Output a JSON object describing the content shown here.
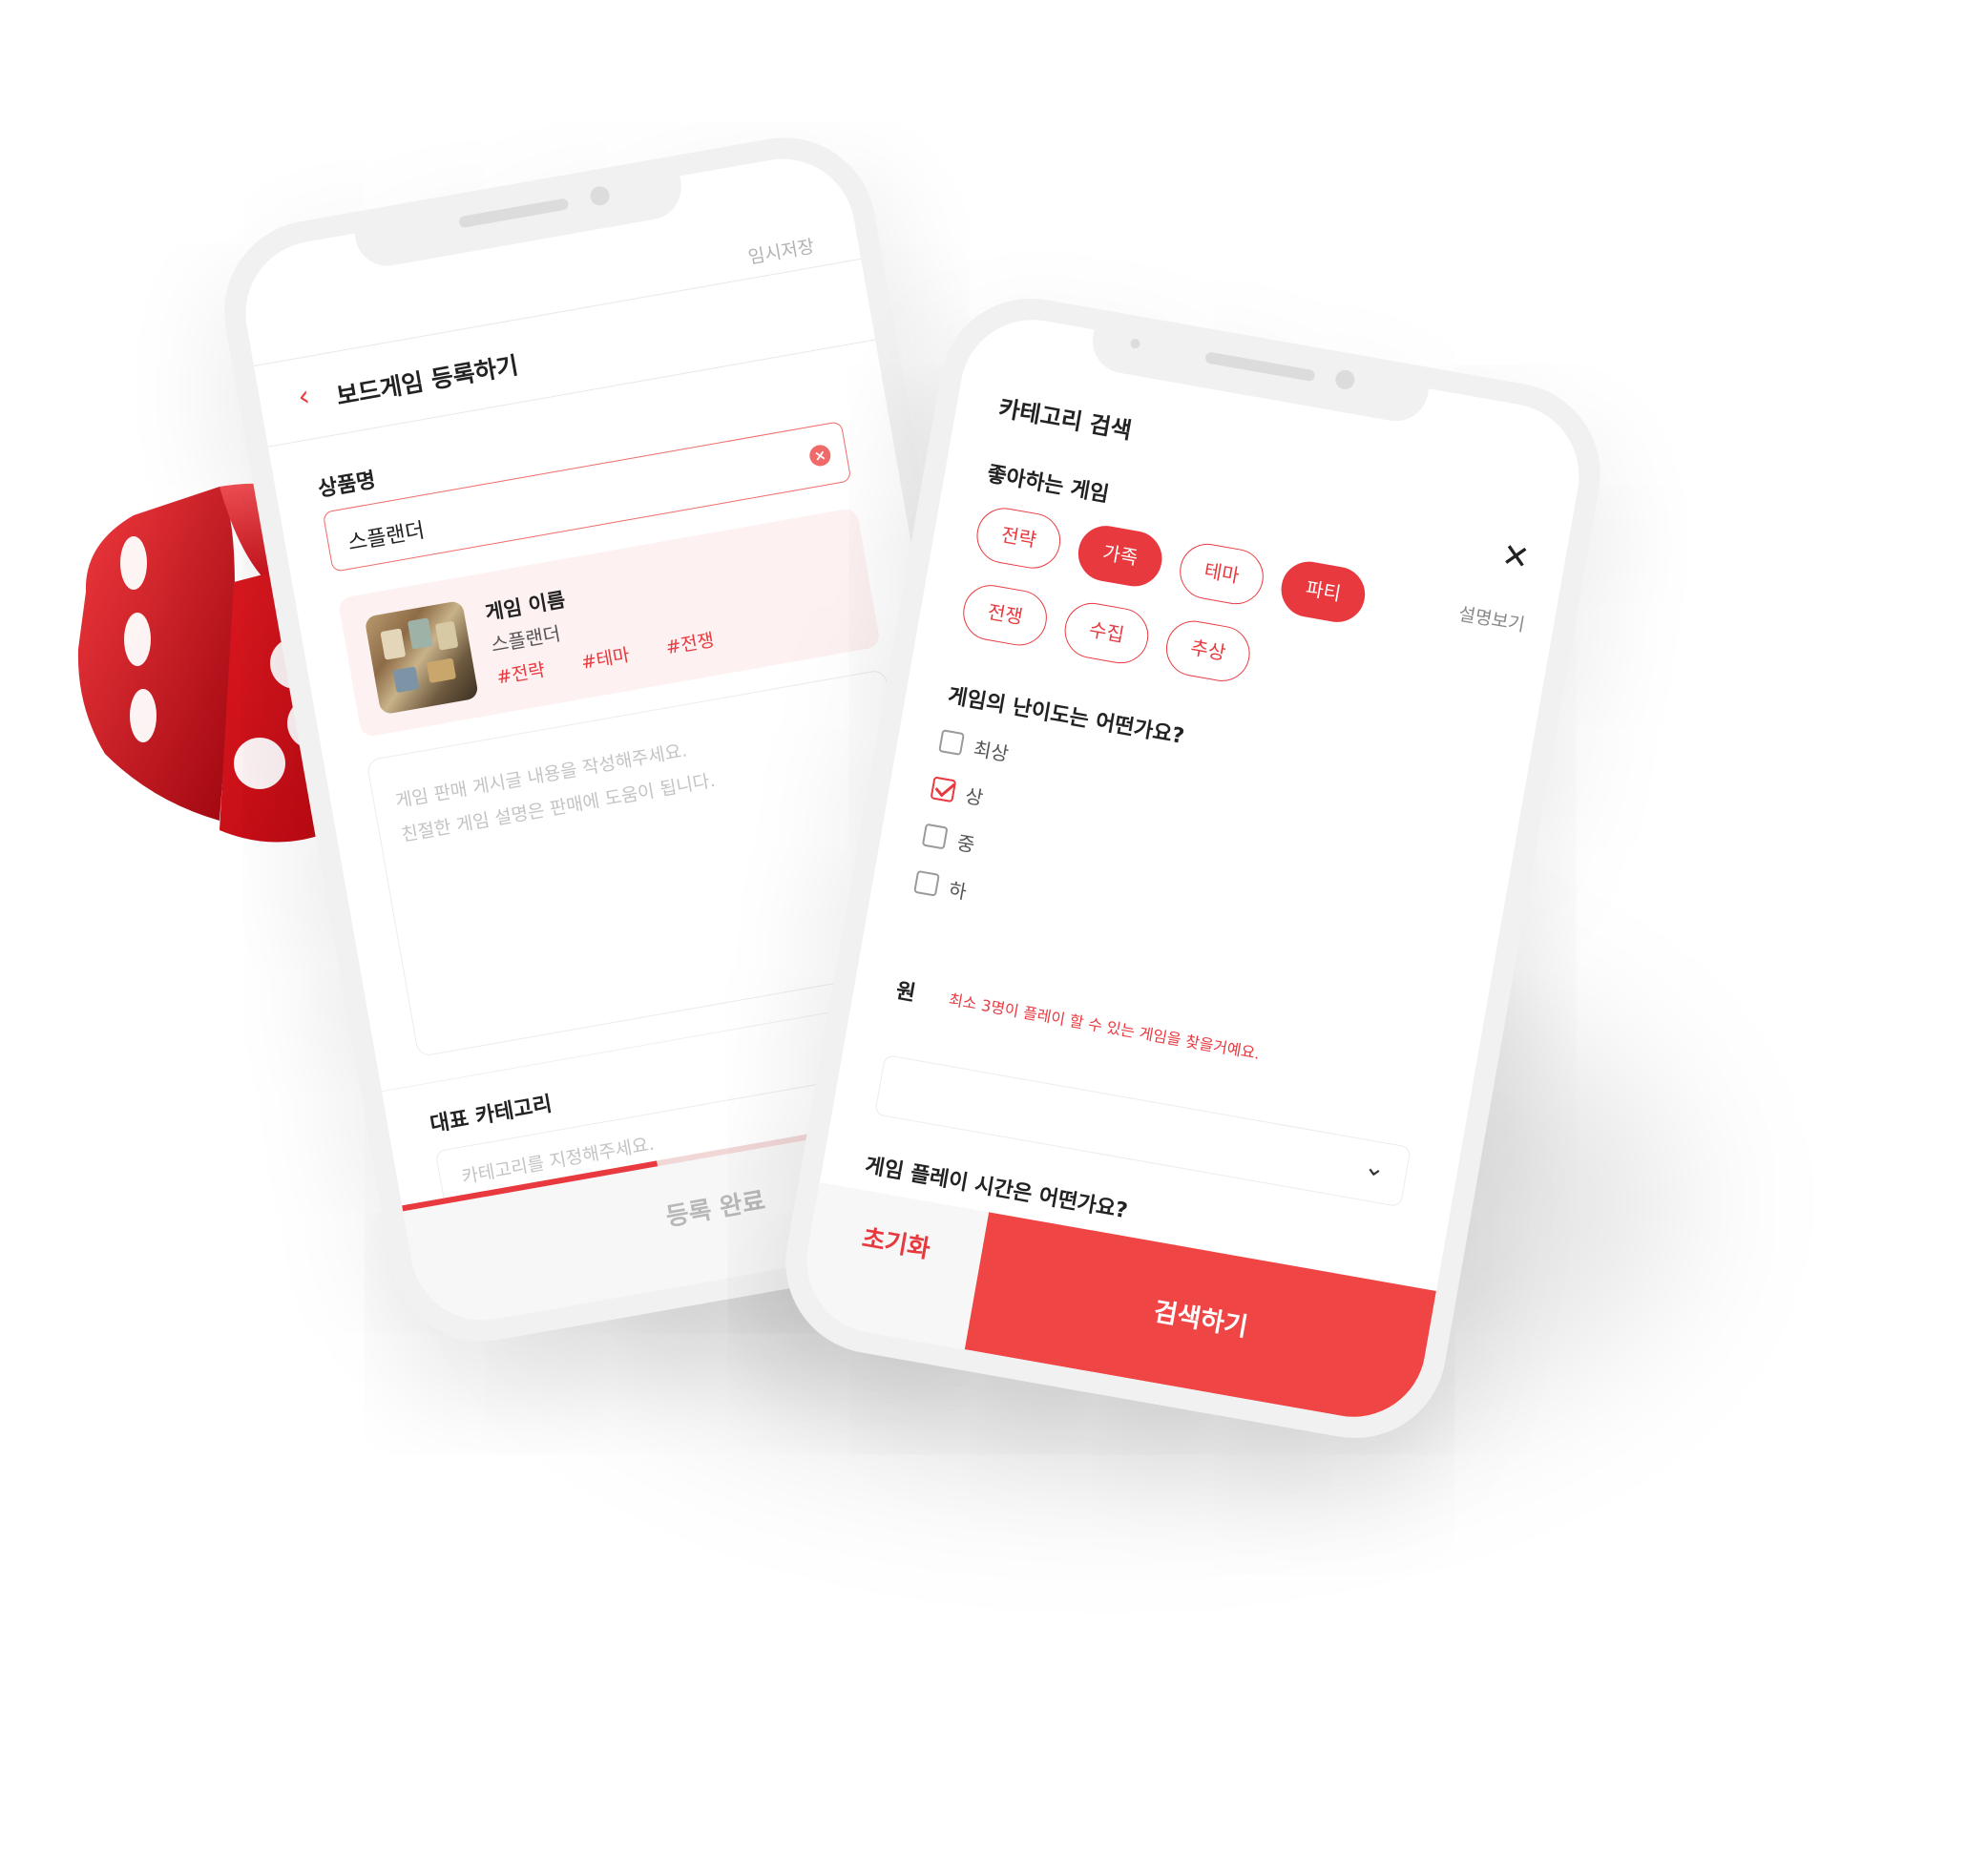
{
  "colors": {
    "accent": "#e8393f",
    "accent_light": "#fdf1f1",
    "dice_red": "#d3111b",
    "phone_frame": "#f1f1f1"
  },
  "register_screen": {
    "temp_save": "임시저장",
    "back_icon": "chevron-left-icon",
    "title": "보드게임 등록하기",
    "product_name_label": "상품명",
    "product_name_value": "스플랜더",
    "clear_icon": "clear-icon",
    "card": {
      "title": "게임 이름",
      "name": "스플랜더",
      "tags": [
        "#전략",
        "#테마",
        "#전쟁"
      ]
    },
    "description_placeholder_line1": "게임 판매 게시글 내용을 작성해주세요.",
    "description_placeholder_line2": "친절한 게임 설명은 판매에 도움이 됩니다.",
    "category_label": "대표 카테고리",
    "category_arrow_icon": "arrow-right-icon",
    "category_placeholder": "카테고리를 지정해주세요.",
    "progress": 0.42,
    "submit_label": "등록 완료"
  },
  "search_screen": {
    "title": "카테고리 검색",
    "close_icon": "close-icon",
    "favorite_label": "좋아하는 게임",
    "description_link": "설명보기",
    "chips": [
      {
        "label": "전략",
        "selected": false
      },
      {
        "label": "가족",
        "selected": true
      },
      {
        "label": "테마",
        "selected": false
      },
      {
        "label": "파티",
        "selected": true
      },
      {
        "label": "전쟁",
        "selected": false
      },
      {
        "label": "수집",
        "selected": false
      },
      {
        "label": "추상",
        "selected": false
      }
    ],
    "difficulty_question": "게임의 난이도는 어떤가요?",
    "difficulty_options": [
      {
        "label": "최상",
        "checked": false
      },
      {
        "label": "상",
        "checked": true
      },
      {
        "label": "중",
        "checked": false
      },
      {
        "label": "하",
        "checked": false
      }
    ],
    "people_label": "원",
    "people_hint": "최소 3명이 플레이 할 수 있는 게임을 찾을거예요.",
    "select_chevron_icon": "chevron-down-icon",
    "playtime_question": "게임 플레이 시간은 어떤가요?",
    "reset_label": "초기화",
    "search_label": "검색하기"
  }
}
